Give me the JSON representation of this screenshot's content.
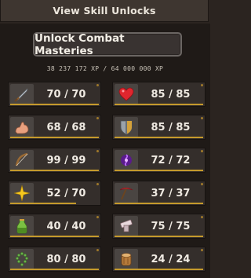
{
  "header": {
    "view_skill_unlocks": "View Skill Unlocks"
  },
  "masteries": {
    "title": "Unlock Combat Masteries"
  },
  "xp": {
    "text": "38 237 172 XP / 64 000 000 XP"
  },
  "skills": [
    {
      "value": "70 / 70",
      "icon": "sword-icon",
      "progress": 1.0
    },
    {
      "value": "85 / 85",
      "icon": "heart-icon",
      "progress": 1.0
    },
    {
      "value": "68 / 68",
      "icon": "flexed-arm-icon",
      "progress": 1.0
    },
    {
      "value": "85 / 85",
      "icon": "shield-icon",
      "progress": 1.0
    },
    {
      "value": "99 / 99",
      "icon": "bow-icon",
      "progress": 1.0
    },
    {
      "value": "72 / 72",
      "icon": "magic-orb-icon",
      "progress": 1.0
    },
    {
      "value": "52 / 70",
      "icon": "star-burst-icon",
      "progress": 0.74
    },
    {
      "value": "37 / 37",
      "icon": "pickaxe-icon",
      "progress": 1.0
    },
    {
      "value": "40 / 40",
      "icon": "green-potion-icon",
      "progress": 1.0
    },
    {
      "value": "75 / 75",
      "icon": "anvil-icon",
      "progress": 1.0
    },
    {
      "value": "80 / 80",
      "icon": "prayer-beads-icon",
      "progress": 1.0
    },
    {
      "value": "24 / 24",
      "icon": "log-icon",
      "progress": 1.0
    }
  ],
  "colors": {
    "progress_bar": "#c59a2c",
    "background": "#1f1a17"
  }
}
